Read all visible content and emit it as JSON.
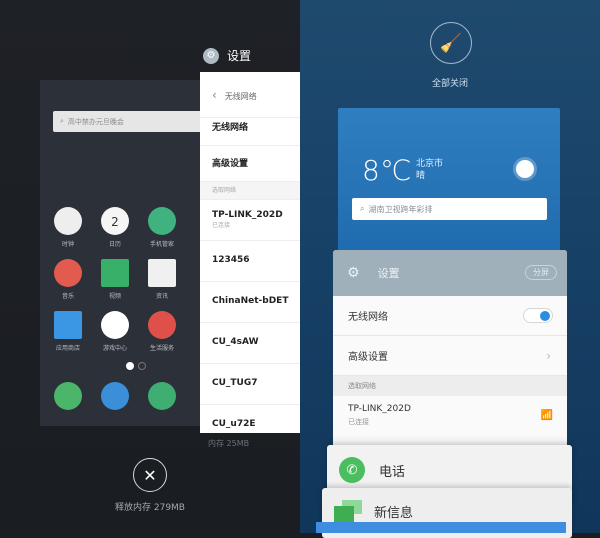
{
  "left_screen": {
    "home_card": {
      "search_placeholder": "高中禁办元旦晚会",
      "apps": [
        {
          "label": "时钟",
          "icon": "clock-icon",
          "color": "#eeeeee"
        },
        {
          "label": "日历",
          "icon": "calendar-icon",
          "color": "#f5f5f5",
          "badge": "2"
        },
        {
          "label": "手机管家",
          "icon": "phone-manager-icon",
          "color": "#3fb27f"
        },
        {
          "label": "音乐",
          "icon": "music-icon",
          "color": "#e25b4f"
        },
        {
          "label": "视频",
          "icon": "video-icon",
          "color": "#39b06a"
        },
        {
          "label": "资讯",
          "icon": "news-icon",
          "color": "#f0f0f0"
        },
        {
          "label": "应用商店",
          "icon": "app-store-icon",
          "color": "#3b97e3"
        },
        {
          "label": "游戏中心",
          "icon": "game-center-icon",
          "color": "#ffffff"
        },
        {
          "label": "生活服务",
          "icon": "life-service-icon",
          "color": "#e0504a"
        }
      ],
      "dock": [
        {
          "icon": "phone-icon",
          "color": "#4bb56a"
        },
        {
          "icon": "browser-icon",
          "color": "#3a8fd8"
        },
        {
          "icon": "messages-icon",
          "color": "#3fae72"
        }
      ]
    },
    "settings_app": {
      "title": "设置",
      "header": "无线网络",
      "rows": [
        "无线网络",
        "高级设置"
      ],
      "section": "选取网络",
      "networks": [
        {
          "name": "TP-LINK_202D",
          "status": "已连接"
        },
        {
          "name": "123456"
        },
        {
          "name": "ChinaNet-bDET"
        },
        {
          "name": "CU_4sAW"
        },
        {
          "name": "CU_TUG7"
        },
        {
          "name": "CU_u72E"
        }
      ],
      "memory": "内存 25MB"
    },
    "release_label": "释放内存 279MB"
  },
  "right_screen": {
    "clear_all_label": "全部关闭",
    "weather": {
      "temperature": "8℃",
      "city": "北京市",
      "condition": "晴",
      "search_placeholder": "湖南卫视跨年彩排"
    },
    "settings_card": {
      "title": "设置",
      "split_label": "分屏",
      "wifi_row": "无线网络",
      "wifi_on": true,
      "advanced_row": "高级设置",
      "section": "选取网络",
      "network": {
        "name": "TP-LINK_202D",
        "status": "已连接"
      }
    },
    "phone_card": {
      "label": "电话"
    },
    "messages_card": {
      "label": "新信息"
    }
  }
}
